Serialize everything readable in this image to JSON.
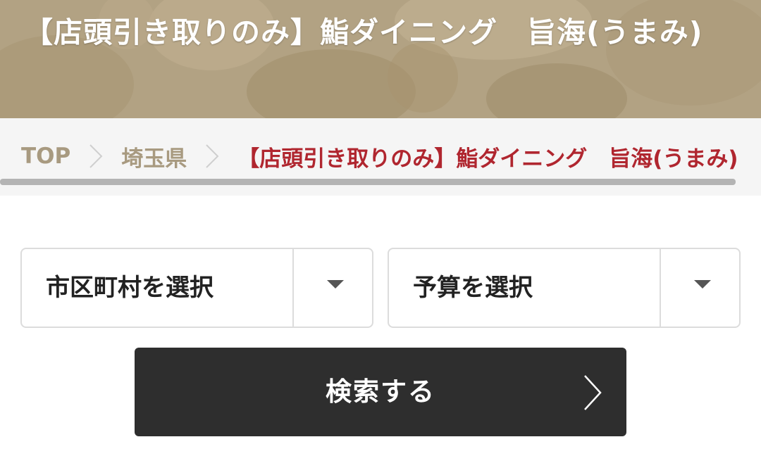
{
  "page": {
    "title": "【店頭引き取りのみ】鮨ダイニング　旨海(うまみ)"
  },
  "breadcrumb": {
    "items": [
      {
        "label": "TOP"
      },
      {
        "label": "埼玉県"
      },
      {
        "label": "【店頭引き取りのみ】鮨ダイニング　旨海(うまみ)"
      }
    ]
  },
  "filters": {
    "city": {
      "label": "市区町村を選択",
      "icon": "caret-down-icon"
    },
    "budget": {
      "label": "予算を選択",
      "icon": "caret-down-icon"
    }
  },
  "search": {
    "label": "検索する",
    "icon": "chevron-right-icon"
  },
  "colors": {
    "hero_bg": "#b3a386",
    "breadcrumb_text": "#a89a80",
    "breadcrumb_current": "#b0262f",
    "button_bg": "#2e2e2e"
  }
}
